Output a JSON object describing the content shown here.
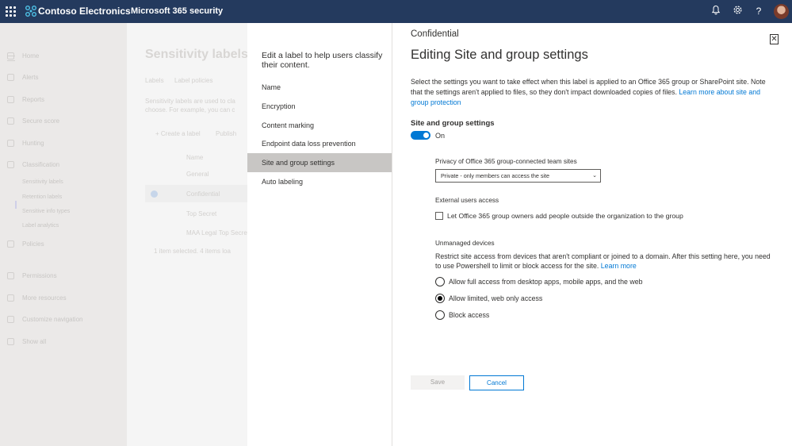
{
  "topbar": {
    "brand": "Contoso Electronics",
    "product": "Microsoft 365 security",
    "icons": [
      "bell-icon",
      "gear-icon",
      "help-icon"
    ]
  },
  "background": {
    "title": "Sensitivity labels",
    "tabs": [
      "Labels",
      "Label policies"
    ],
    "description": [
      "Sensitivity labels are used to cla",
      "choose. For example, you can c"
    ],
    "toolbar": [
      "+ Create a label",
      "Publish"
    ],
    "rows": [
      "Name",
      "General",
      "Confidential",
      "Top Secret",
      "MAA Legal Top Secret"
    ],
    "footer": "1 item selected.  4 items loa",
    "nav": {
      "items": [
        "Home",
        "Alerts",
        "Reports",
        "Secure score",
        "Hunting",
        "Classification",
        "Policies",
        "Permissions",
        "More resources",
        "Customize navigation",
        "Show all"
      ],
      "sub_items": [
        "Sensitivity labels",
        "Retention labels",
        "Sensitive info types",
        "Label analytics"
      ]
    }
  },
  "steps": {
    "intro": "Edit a label to help users classify their content.",
    "items": [
      "Name",
      "Encryption",
      "Content marking",
      "Endpoint data loss prevention",
      "Site and group settings",
      "Auto labeling"
    ],
    "active_index": 4
  },
  "edit": {
    "label_name": "Confidential",
    "heading": "Editing Site and group settings",
    "description": "Select the settings you want to take effect when this label is applied to an Office 365 group or SharePoint site. Note that the settings aren't applied to files, so they don't impact downloaded copies of files.",
    "description_link": "Learn more about site and group protection",
    "section_title": "Site and group settings",
    "toggle_label": "On",
    "toggle_on": true,
    "privacy": {
      "title": "Privacy of Office 365 group-connected team sites",
      "selected": "Private - only members can access the site"
    },
    "external": {
      "title": "External users access",
      "checkbox_label": "Let Office 365 group owners add people outside the organization to the group",
      "checked": false
    },
    "unmanaged": {
      "title": "Unmanaged devices",
      "description": "Restrict site access from devices that aren't compliant or joined to a domain. After this setting here, you need to use Powershell to limit or block access for the site.",
      "link": "Learn more",
      "options": [
        {
          "label": "Allow full access from desktop apps, mobile apps, and the web",
          "selected": false
        },
        {
          "label": "Allow limited, web only access",
          "selected": true
        },
        {
          "label": "Block access",
          "selected": false
        }
      ]
    },
    "save_label": "Save",
    "cancel_label": "Cancel"
  },
  "colors": {
    "topbar": "#243a5e",
    "accent": "#0078d4",
    "active_step": "#c8c6c4"
  }
}
